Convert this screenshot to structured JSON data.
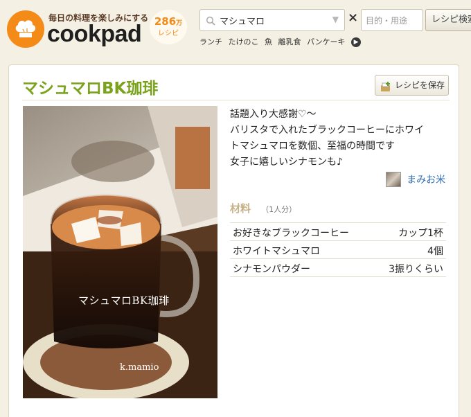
{
  "header": {
    "logo_tagline": "毎日の料理を楽しみにする",
    "logo_word": "cookpad",
    "recipe_count": "286",
    "recipe_count_unit": "万",
    "recipe_count_label": "レシピ",
    "search": {
      "value": "マシュマロ"
    },
    "clear_symbol": "×",
    "purpose": {
      "placeholder": "目的・用途"
    },
    "search_button": "レシピ検索",
    "keywords": [
      "ランチ",
      "たけのこ",
      "魚",
      "離乳食",
      "パンケーキ"
    ]
  },
  "recipe": {
    "title": "マシュマロBK珈琲",
    "save_button": "レシピを保存",
    "photo_caption": "マシュマロBK珈琲",
    "photo_credit": "k.mamio",
    "description_lines": [
      "話題入り大感謝♡～",
      "バリスタで入れたブラックコーヒーにホワイ",
      "トマシュマロを数個、至福の時間です",
      "女子に嬉しいシナモンも♪"
    ],
    "author": "まみお米",
    "ingredients_title": "材料",
    "servings": "（1人分）",
    "ingredients": [
      {
        "name": "お好きなブラックコーヒー",
        "qty": "カップ1杯"
      },
      {
        "name": "ホワイトマシュマロ",
        "qty": "4個"
      },
      {
        "name": "シナモンパウダー",
        "qty": "3振りくらい"
      }
    ]
  },
  "colors": {
    "brand_orange": "#f48a17",
    "title_green": "#7aa31b",
    "author_link": "#2f6fb0",
    "page_bg": "#f4f0e3"
  }
}
